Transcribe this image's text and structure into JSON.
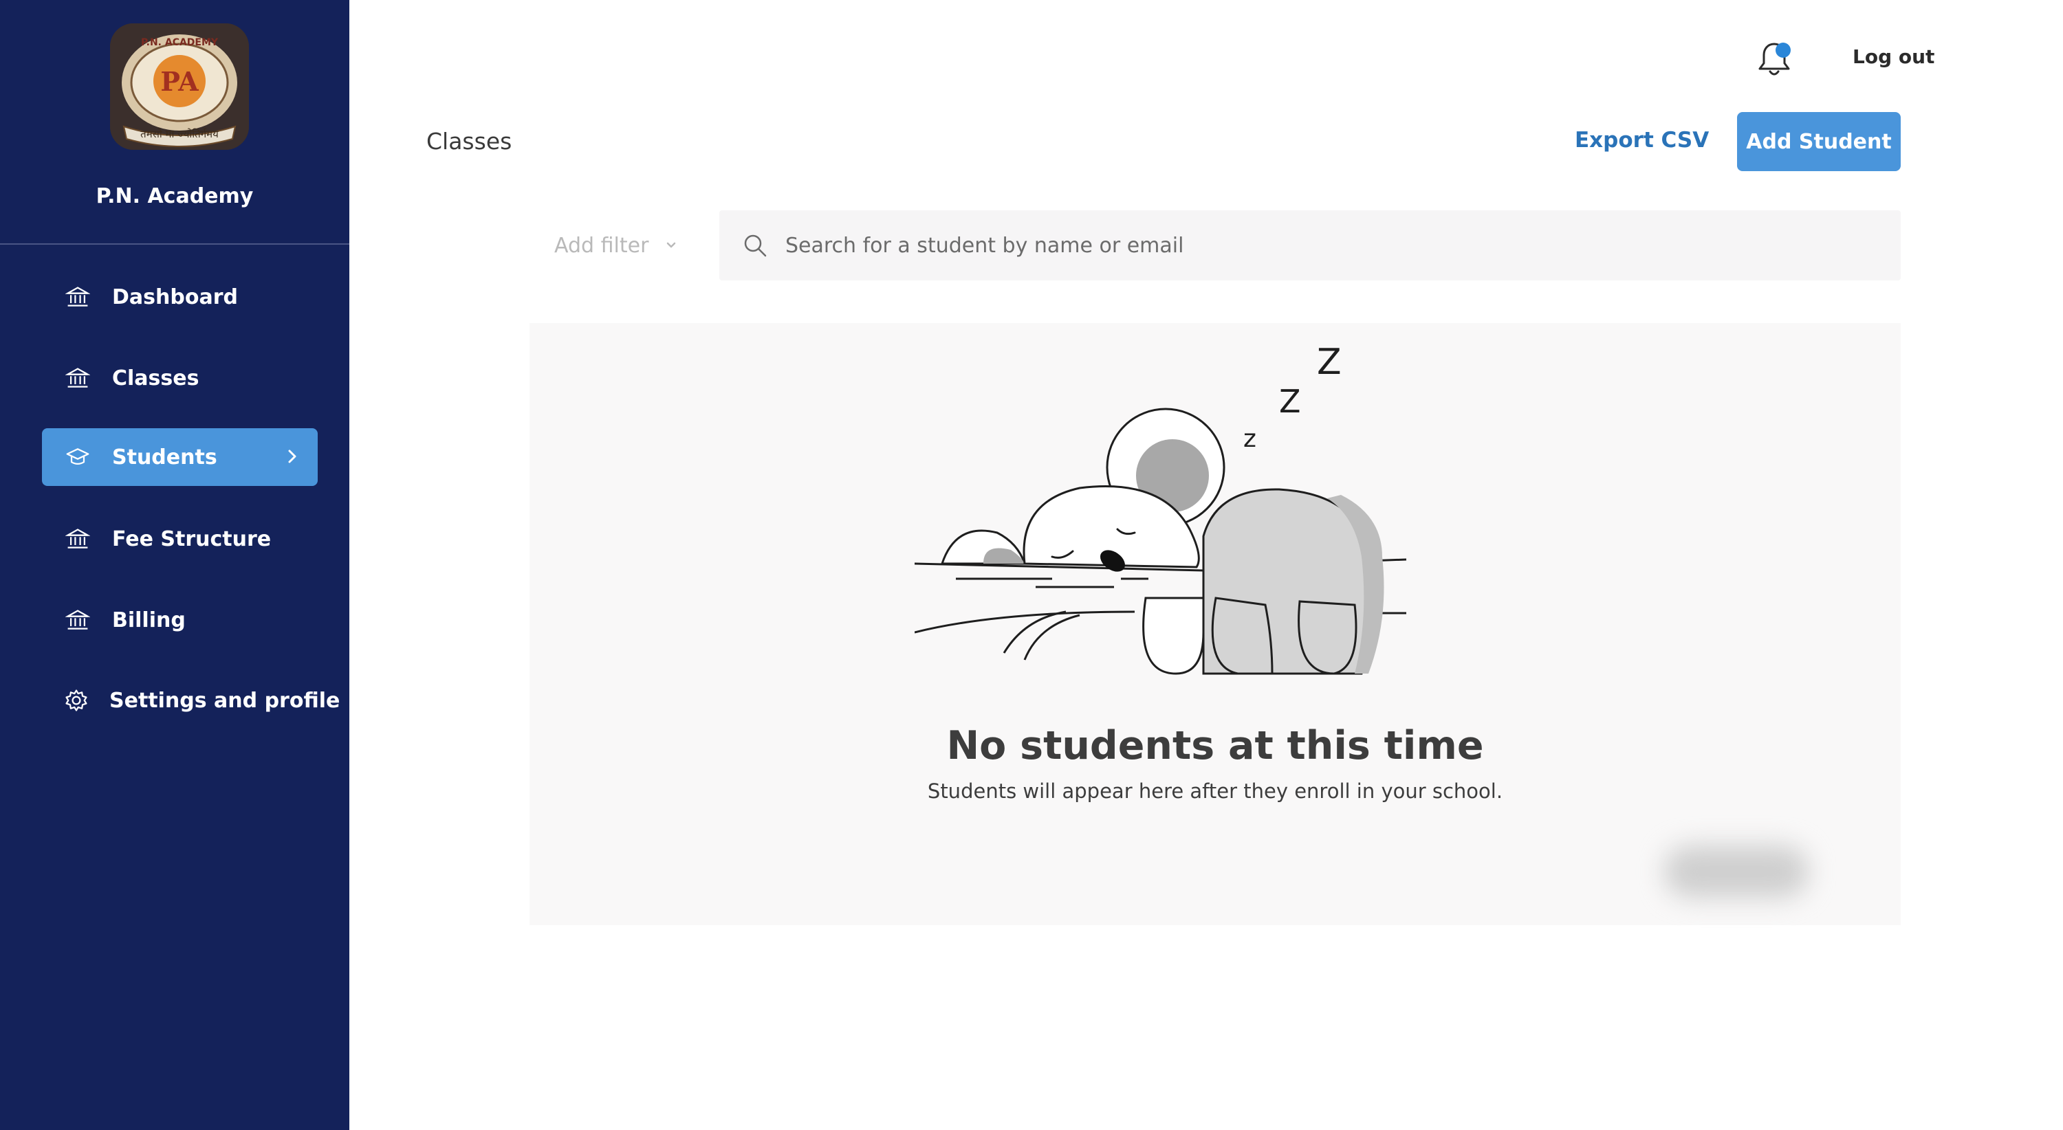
{
  "sidebar": {
    "org_name": "P.N. Academy",
    "logo_text_top": "P.N. ACADEMY",
    "logo_monogram": "PA",
    "logo_text_bottom": "तमसो मा ज्योतिर्गमय",
    "items": [
      {
        "label": "Dashboard",
        "icon": "bank-icon"
      },
      {
        "label": "Classes",
        "icon": "bank-icon"
      },
      {
        "label": "Students",
        "icon": "graduation-cap-icon",
        "active": true
      },
      {
        "label": "Fee Structure",
        "icon": "bank-icon"
      },
      {
        "label": "Billing",
        "icon": "bank-icon"
      },
      {
        "label": "Settings and profile",
        "icon": "gear-icon"
      }
    ]
  },
  "header": {
    "logout_label": "Log out",
    "notification_icon": "bell-icon"
  },
  "toolbar": {
    "page_title": "Classes",
    "export_label": "Export CSV",
    "add_label": "Add Student"
  },
  "filter": {
    "placeholder": "Add filter"
  },
  "search": {
    "placeholder": "Search for a student by name or email"
  },
  "empty_state": {
    "title": "No students at this time",
    "subtitle": "Students will appear here after they enroll in your school.",
    "illustration": "sleeping-koala-illustration"
  },
  "colors": {
    "sidebar_bg": "#14225a",
    "accent": "#4a95db",
    "link": "#2a73b8"
  }
}
